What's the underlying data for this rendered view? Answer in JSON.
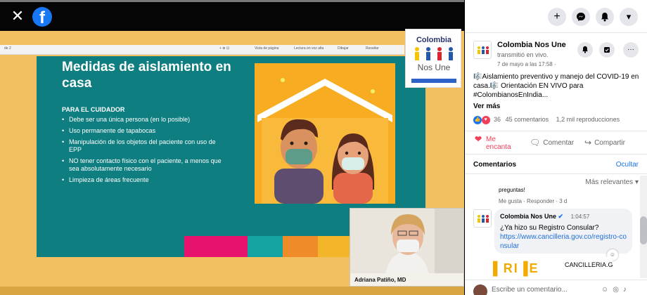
{
  "viewer": {
    "close_glyph": "✕",
    "facebook_logo_letter": "f"
  },
  "slide": {
    "title": "Medidas de aislamiento en casa",
    "subtitle": "PARA EL CUIDADOR",
    "bullets": [
      "Debe ser una única persona (en lo posible)",
      "Uso permanente de tapabocas",
      "Manipulación de los objetos del paciente con uso de EPP",
      "NO tener contacto físico con el paciente, a menos que sea absolutamente necesario",
      "Limpieza de áreas frecuente"
    ]
  },
  "stream_logo": {
    "line1": "Colombia",
    "line2": "Nos Une"
  },
  "camera": {
    "speaker_name": "Adriana Patiño, MD"
  },
  "topnav": {
    "plus_icon": "+",
    "messenger_icon": "messenger-icon",
    "notifications_icon": "bell-icon",
    "account_icon": "▾"
  },
  "post": {
    "page_name": "Colombia Nos Une",
    "subtitle": "transmitió en vivo.",
    "date": "7 de mayo a las 17:58 ·",
    "text": "🎼Aislamiento preventivo y manejo del COVID-19 en casa.🎼 Orientación EN VIVO para #ColombianosEnIndia...",
    "see_more": "Ver más",
    "reaction_count": "36",
    "comments_count": "45 comentarios",
    "views": "1,2 mil reproducciones",
    "actions": {
      "like": "Me encanta",
      "comment": "Comentar",
      "share": "Compartir"
    }
  },
  "comments": {
    "header": "Comentarios",
    "hide": "Ocultar",
    "sort": "Más relevantes",
    "prev_cut": "preguntas!",
    "prev_meta": "Me gusta · Responder · 3 d",
    "items": [
      {
        "author": "Colombia Nos Une",
        "time": "1:04:57",
        "text": "¿Ya hizo su Registro Consular?",
        "link": "https://www.cancilleria.gov.co/registro-consular",
        "card_domain": "CANCILLERIA.GOV.CO"
      }
    ],
    "write_placeholder": "Escribe un comentario..."
  },
  "colors": {
    "facebook_blue": "#1877f2",
    "slide_teal": "#0f7e80",
    "stream_orange": "#f2c061",
    "love_red": "#f33e58"
  }
}
